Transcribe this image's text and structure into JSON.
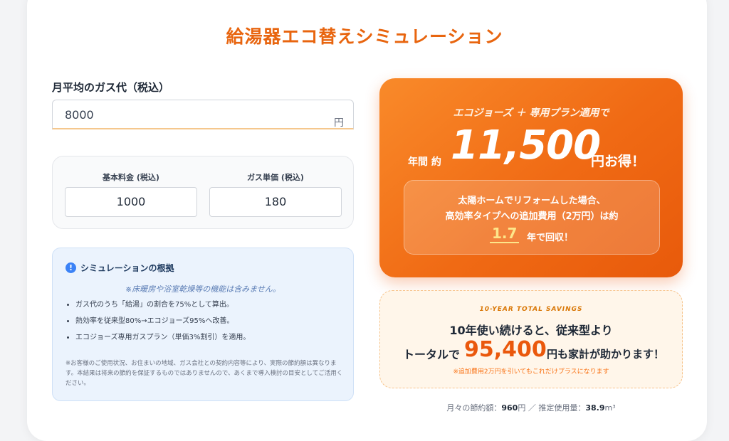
{
  "title": "給湯器エコ替えシミュレーション",
  "gas_input": {
    "label": "月平均のガス代（税込）",
    "value": "8000",
    "unit": "円"
  },
  "fees": {
    "base_label": "基本料金 (税込)",
    "base_value": "1000",
    "unit_label": "ガス単価 (税込)",
    "unit_value": "180"
  },
  "basis": {
    "icon": "info-icon",
    "title": "シミュレーションの根拠",
    "note": "※床暖房や浴室乾燥等の機能は含みません。",
    "items": [
      "ガス代のうち「給湯」の割合を75%として算出。",
      "熱効率を従来型80%→エコジョーズ95%へ改善。",
      "エコジョーズ専用ガスプラン（単価3%割引）を適用。"
    ],
    "disclaimer": "※お客様のご使用状況、お住まいの地域、ガス会社との契約内容等により、実際の節約額は異なります。本結果は将来の節約を保証するものではありませんので、あくまで導入検討の目安としてご活用ください。"
  },
  "result": {
    "subtitle": "エコジョーズ ＋ 専用プラン適用で",
    "annual_prefix": "年間 約",
    "annual_amount": "11,500",
    "annual_suffix": "円お得！",
    "payback_line1": "太陽ホームでリフォームした場合、",
    "payback_line2": "高効率タイプへの追加費用（2万円）は約",
    "payback_years": "1.7",
    "payback_suffix": "年で回収！"
  },
  "savings": {
    "heading": "10-YEAR TOTAL SAVINGS",
    "line1": "10年使い続けると、従来型より",
    "line2_prefix": "トータルで",
    "amount": "95,400",
    "line2_suffix": "円も家計が助かります！",
    "note": "※追加費用2万円を引いてもこれだけプラスになります"
  },
  "monthly": {
    "saving_label": "月々の節約額：",
    "saving_value": "960",
    "saving_unit": "円",
    "separator": "／",
    "usage_label": "推定使用量：",
    "usage_value": "38.9",
    "usage_unit": "m³"
  },
  "colors": {
    "accent": "#e8650f",
    "highlight": "#fde68a",
    "info": "#3b82f6"
  }
}
